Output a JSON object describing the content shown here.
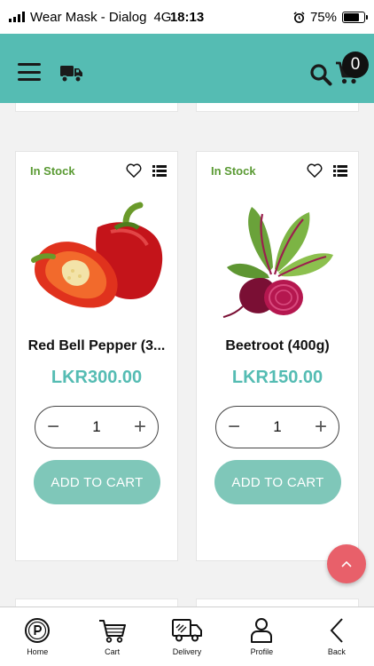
{
  "status_bar": {
    "carrier": "Wear Mask - Dialog",
    "network": "4G",
    "time": "18:13",
    "battery": "75%",
    "battery_level": 0.75
  },
  "header": {
    "accent_color": "#55bcb3",
    "cart_count": "0",
    "icons": [
      "menu-icon",
      "truck-icon",
      "search-icon",
      "cart-icon"
    ]
  },
  "products": [
    {
      "stock": "In Stock",
      "name": "Red Bell Pepper (3...",
      "price": "LKR300.00",
      "quantity": "1",
      "add_label": "ADD TO CART",
      "minus": "−",
      "plus": "+"
    },
    {
      "stock": "In Stock",
      "name": "Beetroot (400g)",
      "price": "LKR150.00",
      "quantity": "1",
      "add_label": "ADD TO CART",
      "minus": "−",
      "plus": "+"
    }
  ],
  "colors": {
    "stock": "#5a9a33",
    "price": "#55bcb3",
    "add_button": "#7fc7b9",
    "fab": "#e8606a"
  },
  "bottom_nav": {
    "items": [
      {
        "label": "Home",
        "icon": "home-p-icon"
      },
      {
        "label": "Cart",
        "icon": "cart-icon"
      },
      {
        "label": "Delivery",
        "icon": "delivery-truck-icon"
      },
      {
        "label": "Profile",
        "icon": "profile-icon"
      },
      {
        "label": "Back",
        "icon": "back-chevron-icon"
      }
    ]
  }
}
